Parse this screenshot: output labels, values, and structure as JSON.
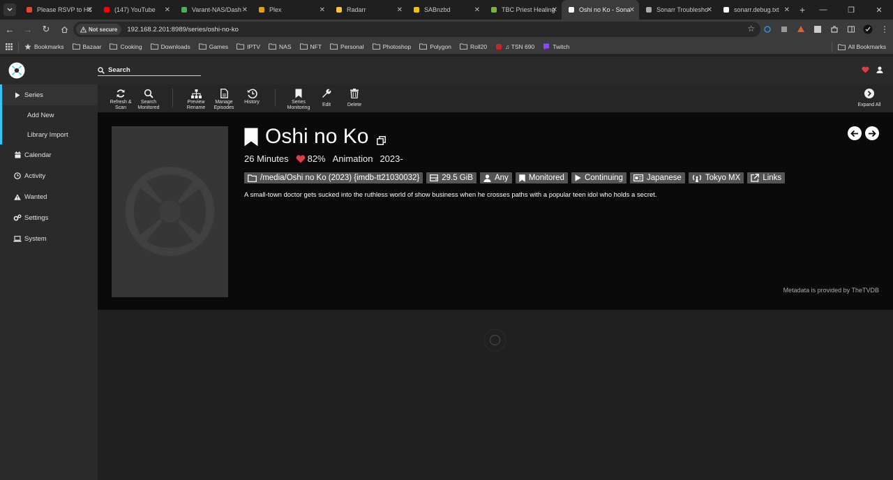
{
  "browser": {
    "tabs": [
      {
        "label": "Please RSVP to HC",
        "icon": "gmail-icon",
        "color": "#ea4335"
      },
      {
        "label": "(147) YouTube",
        "icon": "youtube-icon",
        "color": "#ff0000"
      },
      {
        "label": "Varant-NAS/Dash",
        "icon": "green-dot-icon",
        "color": "#4caf50"
      },
      {
        "label": "Plex",
        "icon": "plex-icon",
        "color": "#e5a00d"
      },
      {
        "label": "Radarr",
        "icon": "radarr-icon",
        "color": "#ffc230"
      },
      {
        "label": "SABnzbd",
        "icon": "sabnzbd-icon",
        "color": "#f5c400"
      },
      {
        "label": "TBC Priest Healing",
        "icon": "wow-icon",
        "color": "#7cb342"
      },
      {
        "label": "Oshi no Ko - Sona",
        "icon": "sonarr-icon",
        "color": "#ffffff"
      },
      {
        "label": "Sonarr Troublesho",
        "icon": "sonarr-icon",
        "color": "#aaaaaa"
      },
      {
        "label": "sonarr.debug.txt",
        "icon": "github-icon",
        "color": "#ffffff"
      }
    ],
    "active_tab_index": 7,
    "new_tab": "+",
    "not_secure_label": "Not secure",
    "url": "192.168.2.201:8989/series/oshi-no-ko"
  },
  "bookmarks_bar": {
    "items": [
      {
        "label": "Bookmarks",
        "icon": "star-icon"
      },
      {
        "label": "Bazaar",
        "icon": "folder-icon"
      },
      {
        "label": "Cooking",
        "icon": "folder-icon"
      },
      {
        "label": "Downloads",
        "icon": "folder-icon"
      },
      {
        "label": "Games",
        "icon": "folder-icon"
      },
      {
        "label": "IPTV",
        "icon": "folder-icon"
      },
      {
        "label": "NAS",
        "icon": "folder-icon"
      },
      {
        "label": "NFT",
        "icon": "folder-icon"
      },
      {
        "label": "Personal",
        "icon": "folder-icon"
      },
      {
        "label": "Photoshop",
        "icon": "folder-icon"
      },
      {
        "label": "Polygon",
        "icon": "folder-icon"
      },
      {
        "label": "Roll20",
        "icon": "folder-icon"
      },
      {
        "label": "♫ TSN 690",
        "icon": "tsn-icon"
      },
      {
        "label": "Twitch",
        "icon": "twitch-icon"
      }
    ],
    "all_bookmarks": "All Bookmarks"
  },
  "app": {
    "search_label": "Search",
    "sidebar": {
      "items": [
        {
          "label": "Series",
          "icon": "play-icon"
        },
        {
          "label": "Add New"
        },
        {
          "label": "Library Import"
        },
        {
          "label": "Calendar",
          "icon": "calendar-icon"
        },
        {
          "label": "Activity",
          "icon": "clock-icon"
        },
        {
          "label": "Wanted",
          "icon": "warning-icon"
        },
        {
          "label": "Settings",
          "icon": "cogs-icon"
        },
        {
          "label": "System",
          "icon": "laptop-icon"
        }
      ]
    },
    "toolbar": {
      "refresh": "Refresh & Scan",
      "search_monitored": "Search Monitored",
      "preview_rename": "Preview Rename",
      "manage_episodes": "Manage Episodes",
      "history": "History",
      "series_monitoring": "Series Monitoring",
      "edit": "Edit",
      "delete": "Delete",
      "expand_all": "Expand All"
    },
    "series": {
      "title": "Oshi no Ko",
      "runtime": "26 Minutes",
      "rating": "82%",
      "genre": "Animation",
      "years": "2023-",
      "tags": {
        "path": "/media/Oshi no Ko (2023) {imdb-tt21030032}",
        "size": "29.5 GiB",
        "profile": "Any",
        "monitored": "Monitored",
        "status": "Continuing",
        "language": "Japanese",
        "network": "Tokyo MX",
        "links": "Links"
      },
      "overview": "A small-town doctor gets sucked into the ruthless world of show business when he crosses paths with a popular teen idol who holds a secret.",
      "metadata_credit": "Metadata is provided by TheTVDB"
    },
    "colors": {
      "accent": "#35c5f4",
      "heart": "#e03c4a"
    }
  }
}
